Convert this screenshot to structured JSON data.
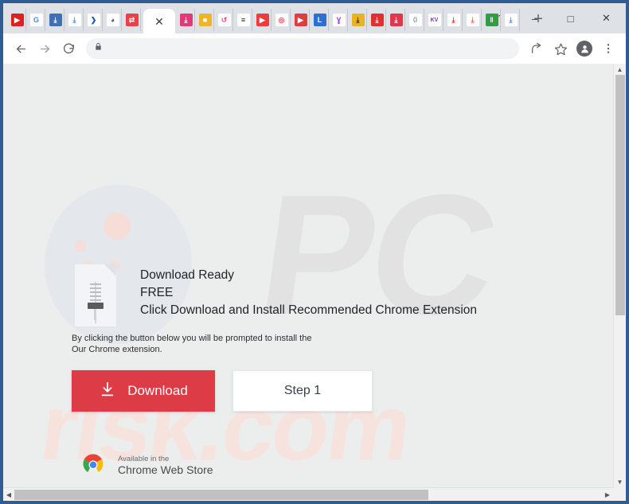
{
  "window": {
    "controls": [
      {
        "name": "tab-search",
        "glyph": "ˇ"
      },
      {
        "name": "minimize",
        "glyph": "–"
      },
      {
        "name": "maximize",
        "glyph": "□"
      },
      {
        "name": "close",
        "glyph": "✕"
      }
    ]
  },
  "tabstrip": {
    "pinned_tabs": [
      {
        "icon": "youtube-icon",
        "glyph": "▶",
        "bg": "#e02020",
        "fg": "#ffffff"
      },
      {
        "icon": "google-icon",
        "glyph": "G",
        "bg": "#ffffff",
        "fg": "#4285f4"
      },
      {
        "icon": "download-blue-icon",
        "glyph": "⤓",
        "bg": "#3f6fb5",
        "fg": "#ffffff"
      },
      {
        "icon": "cloud-download-icon",
        "glyph": "⤓",
        "bg": "#ffffff",
        "fg": "#5b8dd0"
      },
      {
        "icon": "chevron-blue-icon",
        "glyph": "❯",
        "bg": "#ffffff",
        "fg": "#1a56c4"
      },
      {
        "icon": "globe-grey-icon",
        "glyph": "◕",
        "bg": "#ffffff",
        "fg": "#54585c"
      },
      {
        "icon": "convert-red-icon",
        "glyph": "⇄",
        "bg": "#e8414a",
        "fg": "#ffffff"
      }
    ],
    "active_tab": {
      "name": "active-tab",
      "close_glyph": "✕",
      "title": ""
    },
    "pinned_tabs_right": [
      {
        "icon": "download-pink-icon",
        "glyph": "⤓",
        "bg": "#e23a79",
        "fg": "#ffffff"
      },
      {
        "icon": "video-camera-yellow-icon",
        "glyph": "■",
        "bg": "#f0b429",
        "fg": "#ffffff"
      },
      {
        "icon": "refresh-pink-icon",
        "glyph": "↺",
        "bg": "#ffffff",
        "fg": "#e8468a"
      },
      {
        "icon": "flash-black-icon",
        "glyph": "≡",
        "bg": "#ffffff",
        "fg": "#1b1b1b"
      },
      {
        "icon": "play-red-icon",
        "glyph": "▶",
        "bg": "#ee3b3b",
        "fg": "#ffffff"
      },
      {
        "icon": "location-pin-red-icon",
        "glyph": "◎",
        "bg": "#ffffff",
        "fg": "#e0555e"
      },
      {
        "icon": "video-box-red-icon",
        "glyph": "▶",
        "bg": "#e03e3e",
        "fg": "#ffffff"
      },
      {
        "icon": "letter-l-blue-icon",
        "glyph": "L",
        "bg": "#2f6fd0",
        "fg": "#ffffff"
      },
      {
        "icon": "ym-purple-icon",
        "glyph": "Ɣ",
        "bg": "#ffffff",
        "fg": "#8b3fd4"
      },
      {
        "icon": "download-gold-icon",
        "glyph": "⤓",
        "bg": "#e8b520",
        "fg": "#3a3000"
      },
      {
        "icon": "heart-download-red-icon",
        "glyph": "⤓",
        "bg": "#e03030",
        "fg": "#ffffff"
      },
      {
        "icon": "download-crimson-icon",
        "glyph": "⤓",
        "bg": "#e0384a",
        "fg": "#ffffff"
      },
      {
        "icon": "code-grey-icon",
        "glyph": "⟨⟩",
        "bg": "#ffffff",
        "fg": "#777c82"
      },
      {
        "icon": "kv-purple-icon",
        "glyph": "KV",
        "bg": "#ffffff",
        "fg": "#7a2fd0"
      },
      {
        "icon": "download-circle-red-icon",
        "glyph": "⤓",
        "bg": "#ffffff",
        "fg": "#d84040"
      },
      {
        "icon": "download-salmon-icon",
        "glyph": "⤓",
        "bg": "#ffffff",
        "fg": "#ef6a5a"
      },
      {
        "icon": "bars-green-icon",
        "glyph": "‖",
        "bg": "#2f9e44",
        "fg": "#ffffff"
      },
      {
        "icon": "cloud-download-blue-icon",
        "glyph": "⤓",
        "bg": "#ffffff",
        "fg": "#5b8dd0"
      }
    ],
    "new_tab": {
      "name": "new-tab-button",
      "glyph": "+"
    }
  },
  "toolbar": {
    "back": {
      "name": "back-button",
      "glyph": "←"
    },
    "forward": {
      "name": "forward-button",
      "glyph": "→"
    },
    "reload": {
      "name": "reload-button",
      "glyph": "↻"
    },
    "omnibox": {
      "lock_glyph": "⚿",
      "value": "",
      "placeholder": ""
    },
    "share": {
      "name": "share-button",
      "glyph": "➦"
    },
    "bookmark": {
      "name": "bookmark-star-button",
      "glyph": "☆"
    },
    "profile": {
      "name": "profile-avatar-button",
      "glyph": "●"
    },
    "menu": {
      "name": "chrome-menu-button",
      "glyph": "⋮"
    }
  },
  "page": {
    "watermark_primary": "PC",
    "watermark_secondary": "risk.com",
    "file_icon_name": "zip-file-icon",
    "headlines": [
      "Download Ready",
      "FREE",
      "Click Download and Install Recommended Chrome Extension"
    ],
    "sublines": [
      "By clicking the button below you will be prompted to install the",
      "Our Chrome extension."
    ],
    "download_button": {
      "label": "Download",
      "icon": "download-arrow-icon",
      "icon_glyph": "⤓",
      "color": "#dd3b45"
    },
    "step_button": {
      "label": "Step 1",
      "color": "#ffffff"
    },
    "chrome_web_store_badge": {
      "available_text": "Available in the",
      "store_name": "Chrome Web Store",
      "icon": "chrome-logo-icon"
    }
  },
  "scrollbars": {
    "vertical": {
      "up_glyph": "▲",
      "down_glyph": "▼"
    },
    "horizontal": {
      "left_glyph": "◀",
      "right_glyph": "▶"
    }
  },
  "colors": {
    "window_border": "#2e5c94",
    "tabstrip_bg": "#dee1e6",
    "toolbar_bg": "#ffffff",
    "page_bg": "#eceded",
    "accent_red": "#dd3b45"
  }
}
